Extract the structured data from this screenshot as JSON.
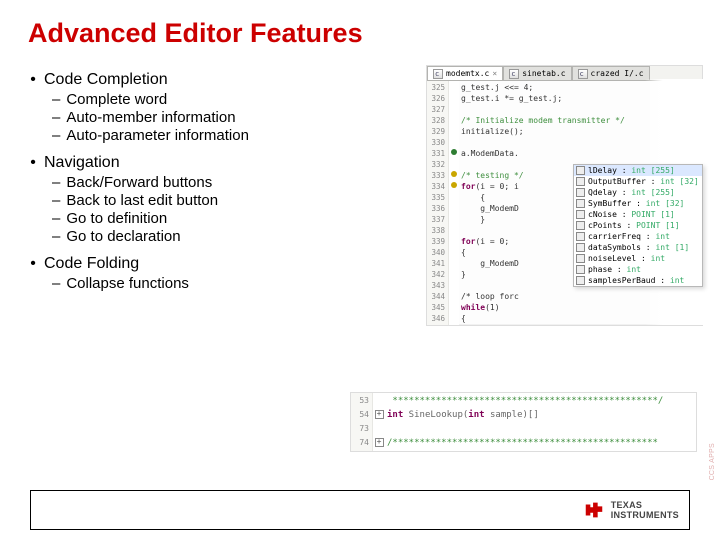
{
  "title": "Advanced Editor Features",
  "bullets": {
    "b1": {
      "label": "Code Completion",
      "items": [
        "Complete word",
        "Auto-member information",
        "Auto-parameter information"
      ]
    },
    "b2": {
      "label": "Navigation",
      "items": [
        "Back/Forward buttons",
        "Back to last edit button",
        "Go to definition",
        "Go to declaration"
      ]
    },
    "b3": {
      "label": "Code Folding",
      "items": [
        "Collapse functions"
      ]
    }
  },
  "editor": {
    "tabs": [
      {
        "name": "modemtx.c",
        "icon": "c"
      },
      {
        "name": "sinetab.c",
        "icon": "c"
      },
      {
        "name": "crazed I/.c",
        "icon": "c"
      }
    ],
    "active_tab": 0,
    "first_line_no": 325,
    "lines": [
      "g_test.j <<= 4;",
      "g_test.i *= g_test.j;",
      "",
      "/* Initialize modem transmitter */",
      "initialize();",
      "",
      "a.ModemData.",
      "",
      "/* testing */",
      "for(i = 0; i",
      "    {",
      "    g_ModemD",
      "    }",
      "",
      "for(i = 0;",
      "{",
      "    g_ModemD",
      "}",
      "",
      "/* loop forc",
      "while(1)",
      "{"
    ],
    "markers": {
      "331": "green",
      "333": "yellow",
      "334": "yellow"
    },
    "popup": [
      {
        "icon": "field",
        "name": "lDelay",
        "type": "int [255]",
        "selected": true
      },
      {
        "icon": "field",
        "name": "OutputBuffer",
        "type": "int [32]"
      },
      {
        "icon": "field",
        "name": "Qdelay",
        "type": "int [255]"
      },
      {
        "icon": "field",
        "name": "SymBuffer",
        "type": "int [32]"
      },
      {
        "icon": "field",
        "name": "cNoise",
        "type": "POINT [1]"
      },
      {
        "icon": "field",
        "name": "cPoints",
        "type": "POINT [1]"
      },
      {
        "icon": "field",
        "name": "carrierFreq",
        "type": "int"
      },
      {
        "icon": "field",
        "name": "dataSymbols",
        "type": "int [1]"
      },
      {
        "icon": "field",
        "name": "noiseLevel",
        "type": "int"
      },
      {
        "icon": "field",
        "name": "phase",
        "type": "int"
      },
      {
        "icon": "field",
        "name": "samplesPerBaud",
        "type": "int"
      }
    ]
  },
  "folding": {
    "lines": [
      {
        "no": "53",
        "fold": "",
        "text": " *************************************************/"
      },
      {
        "no": "54",
        "fold": "+",
        "text": "int SineLookup(int sample)[]"
      },
      {
        "no": "73",
        "fold": "",
        "text": ""
      },
      {
        "no": "74",
        "fold": "+",
        "text": "/*************************************************"
      }
    ]
  },
  "footer": {
    "brand1": "TEXAS",
    "brand2": "INSTRUMENTS"
  },
  "sidetext": "CCS APPS"
}
